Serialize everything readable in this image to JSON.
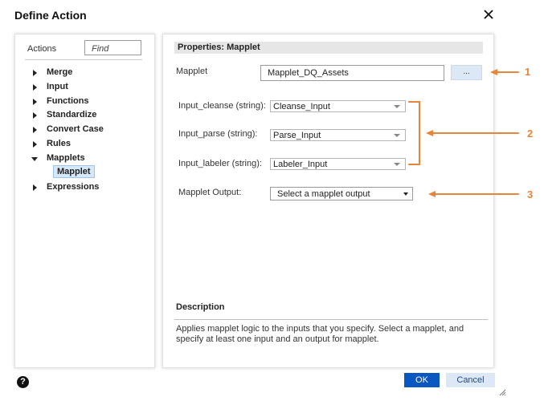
{
  "dialog": {
    "title": "Define Action"
  },
  "left": {
    "actions_label": "Actions",
    "find_placeholder": "Find",
    "items": [
      {
        "label": "Merge",
        "expanded": false
      },
      {
        "label": "Input",
        "expanded": false
      },
      {
        "label": "Functions",
        "expanded": false
      },
      {
        "label": "Standardize",
        "expanded": false
      },
      {
        "label": "Convert Case",
        "expanded": false
      },
      {
        "label": "Rules",
        "expanded": false
      },
      {
        "label": "Mapplets",
        "expanded": true
      },
      {
        "label": "Expressions",
        "expanded": false
      }
    ],
    "selected_subitem": "Mapplet"
  },
  "right": {
    "header": "Properties: Mapplet",
    "mapplet_label": "Mapplet",
    "mapplet_value": "Mapplet_DQ_Assets",
    "browse_label": "...",
    "inputs": [
      {
        "label": "Input_cleanse (string):",
        "value": "Cleanse_Input"
      },
      {
        "label": "Input_parse (string):",
        "value": "Parse_Input"
      },
      {
        "label": "Input_labeler (string):",
        "value": "Labeler_Input"
      }
    ],
    "output_label": "Mapplet Output:",
    "output_value": "Select a mapplet output",
    "description_title": "Description",
    "description_text": "Applies mapplet logic to the inputs that you specify. Select a mapplet, and specify at least one input and an output for mapplet."
  },
  "footer": {
    "help": "?",
    "ok_label": "OK",
    "cancel_label": "Cancel"
  },
  "callouts": [
    "1",
    "2",
    "3"
  ],
  "colors": {
    "primary": "#0a57c2",
    "secondary_btn": "#dce8f6",
    "callout": "#e8843a",
    "selected_bg": "#d6e8fa"
  }
}
